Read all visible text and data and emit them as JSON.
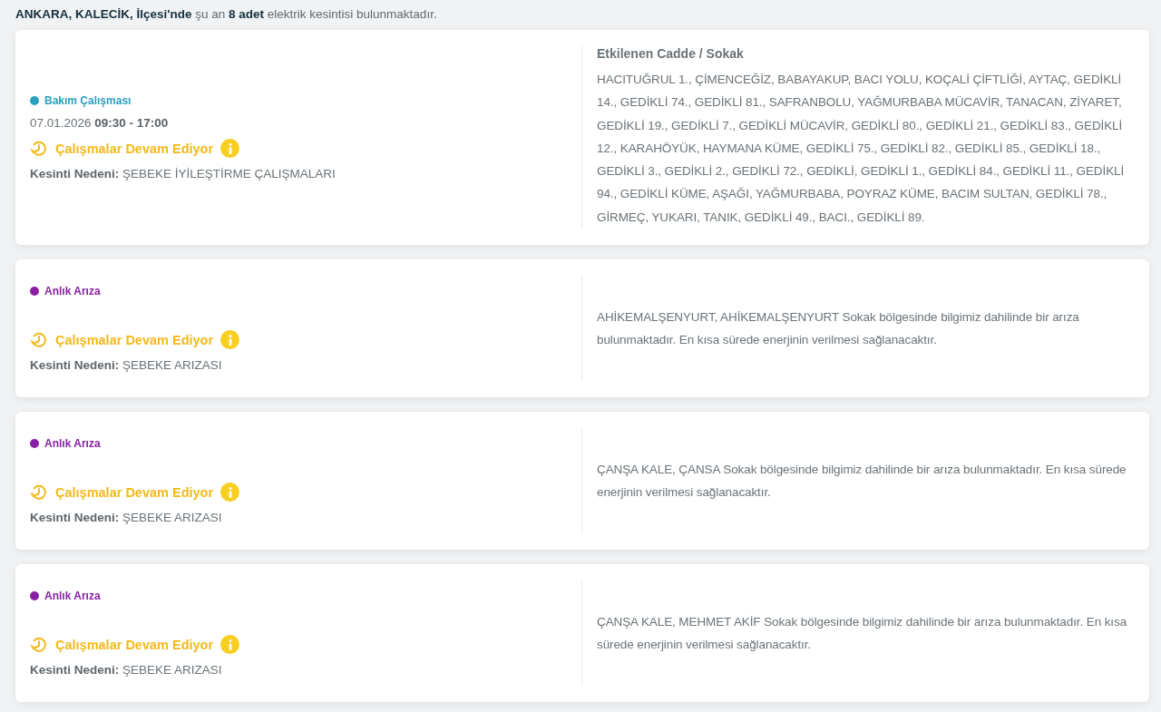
{
  "summary": "**ANKARA, KALECİK, İlçesi'nde** şu an **8 adet** elektrik kesintisi bulunmaktadır.",
  "outages": [
    {
      "type": "Bakım Çalışması",
      "color": "#2a9fbf",
      "date": "07.01.2026 **09:30 - 17:00**",
      "status": "Çalışmalar Devam Ediyor",
      "reason": "**Kesinti Nedeni:** ŞEBEKE İYİLEŞTİRME ÇALIŞMALARI",
      "heading": "Etkilenen Cadde / Sokak",
      "details": "HACITUĞRUL 1., ÇİMENCEĞİZ, BABAYAKUP, BACI YOLU, KOÇALİ ÇİFTLİĞİ, AYTAÇ, GEDİKLİ 14., GEDİKLİ 74., GEDİKLİ 81., SAFRANBOLU, YAĞMURBABA MÜCAVİR, TANACAN, ZİYARET, GEDİKLİ 19., GEDİKLİ 7., GEDİKLİ MÜCAVİR, GEDİKLİ 80., GEDİKLİ 21., GEDİKLİ 83., GEDİKLİ 12., KARAHÖYÜK, HAYMANA KÜME, GEDİKLİ 75., GEDİKLİ 82., GEDİKLİ 85., GEDİKLİ 18., GEDİKLİ 3., GEDİKLİ 2., GEDİKLİ 72., GEDİKLİ, GEDİKLİ 1., GEDİKLİ 84., GEDİKLİ 11., GEDİKLİ 94., GEDİKLİ KÜME, AŞAĞI, YAĞMURBABA, POYRAZ KÜME, BACIM SULTAN, GEDİKLİ 78., GİRMEÇ, YUKARI, TANIK, GEDİKLİ 49., BACI., GEDİKLİ 89."
    },
    {
      "type": "Anlık Arıza",
      "color": "#8a1fa6",
      "status": "Çalışmalar Devam Ediyor",
      "reason": "**Kesinti Nedeni:** ŞEBEKE ARIZASI",
      "details": "AHİKEMALŞENYURT, AHİKEMALŞENYURT Sokak bölgesinde bilgimiz dahilinde bir arıza bulunmaktadır. En kısa sürede enerjinin verilmesi sağlanacaktır."
    },
    {
      "type": "Anlık Arıza",
      "color": "#8a1fa6",
      "status": "Çalışmalar Devam Ediyor",
      "reason": "**Kesinti Nedeni:** ŞEBEKE ARIZASI",
      "details": "ÇANŞA KALE, ÇANSA Sokak bölgesinde bilgimiz dahilinde bir arıza bulunmaktadır. En kısa sürede enerjinin verilmesi sağlanacaktır."
    },
    {
      "type": "Anlık Arıza",
      "color": "#8a1fa6",
      "status": "Çalışmalar Devam Ediyor",
      "reason": "**Kesinti Nedeni:** ŞEBEKE ARIZASI",
      "details": "ÇANŞA KALE, MEHMET AKİF Sokak bölgesinde bilgimiz dahilinde bir arıza bulunmaktadır. En kısa sürede enerjinin verilmesi sağlanacaktır."
    }
  ]
}
